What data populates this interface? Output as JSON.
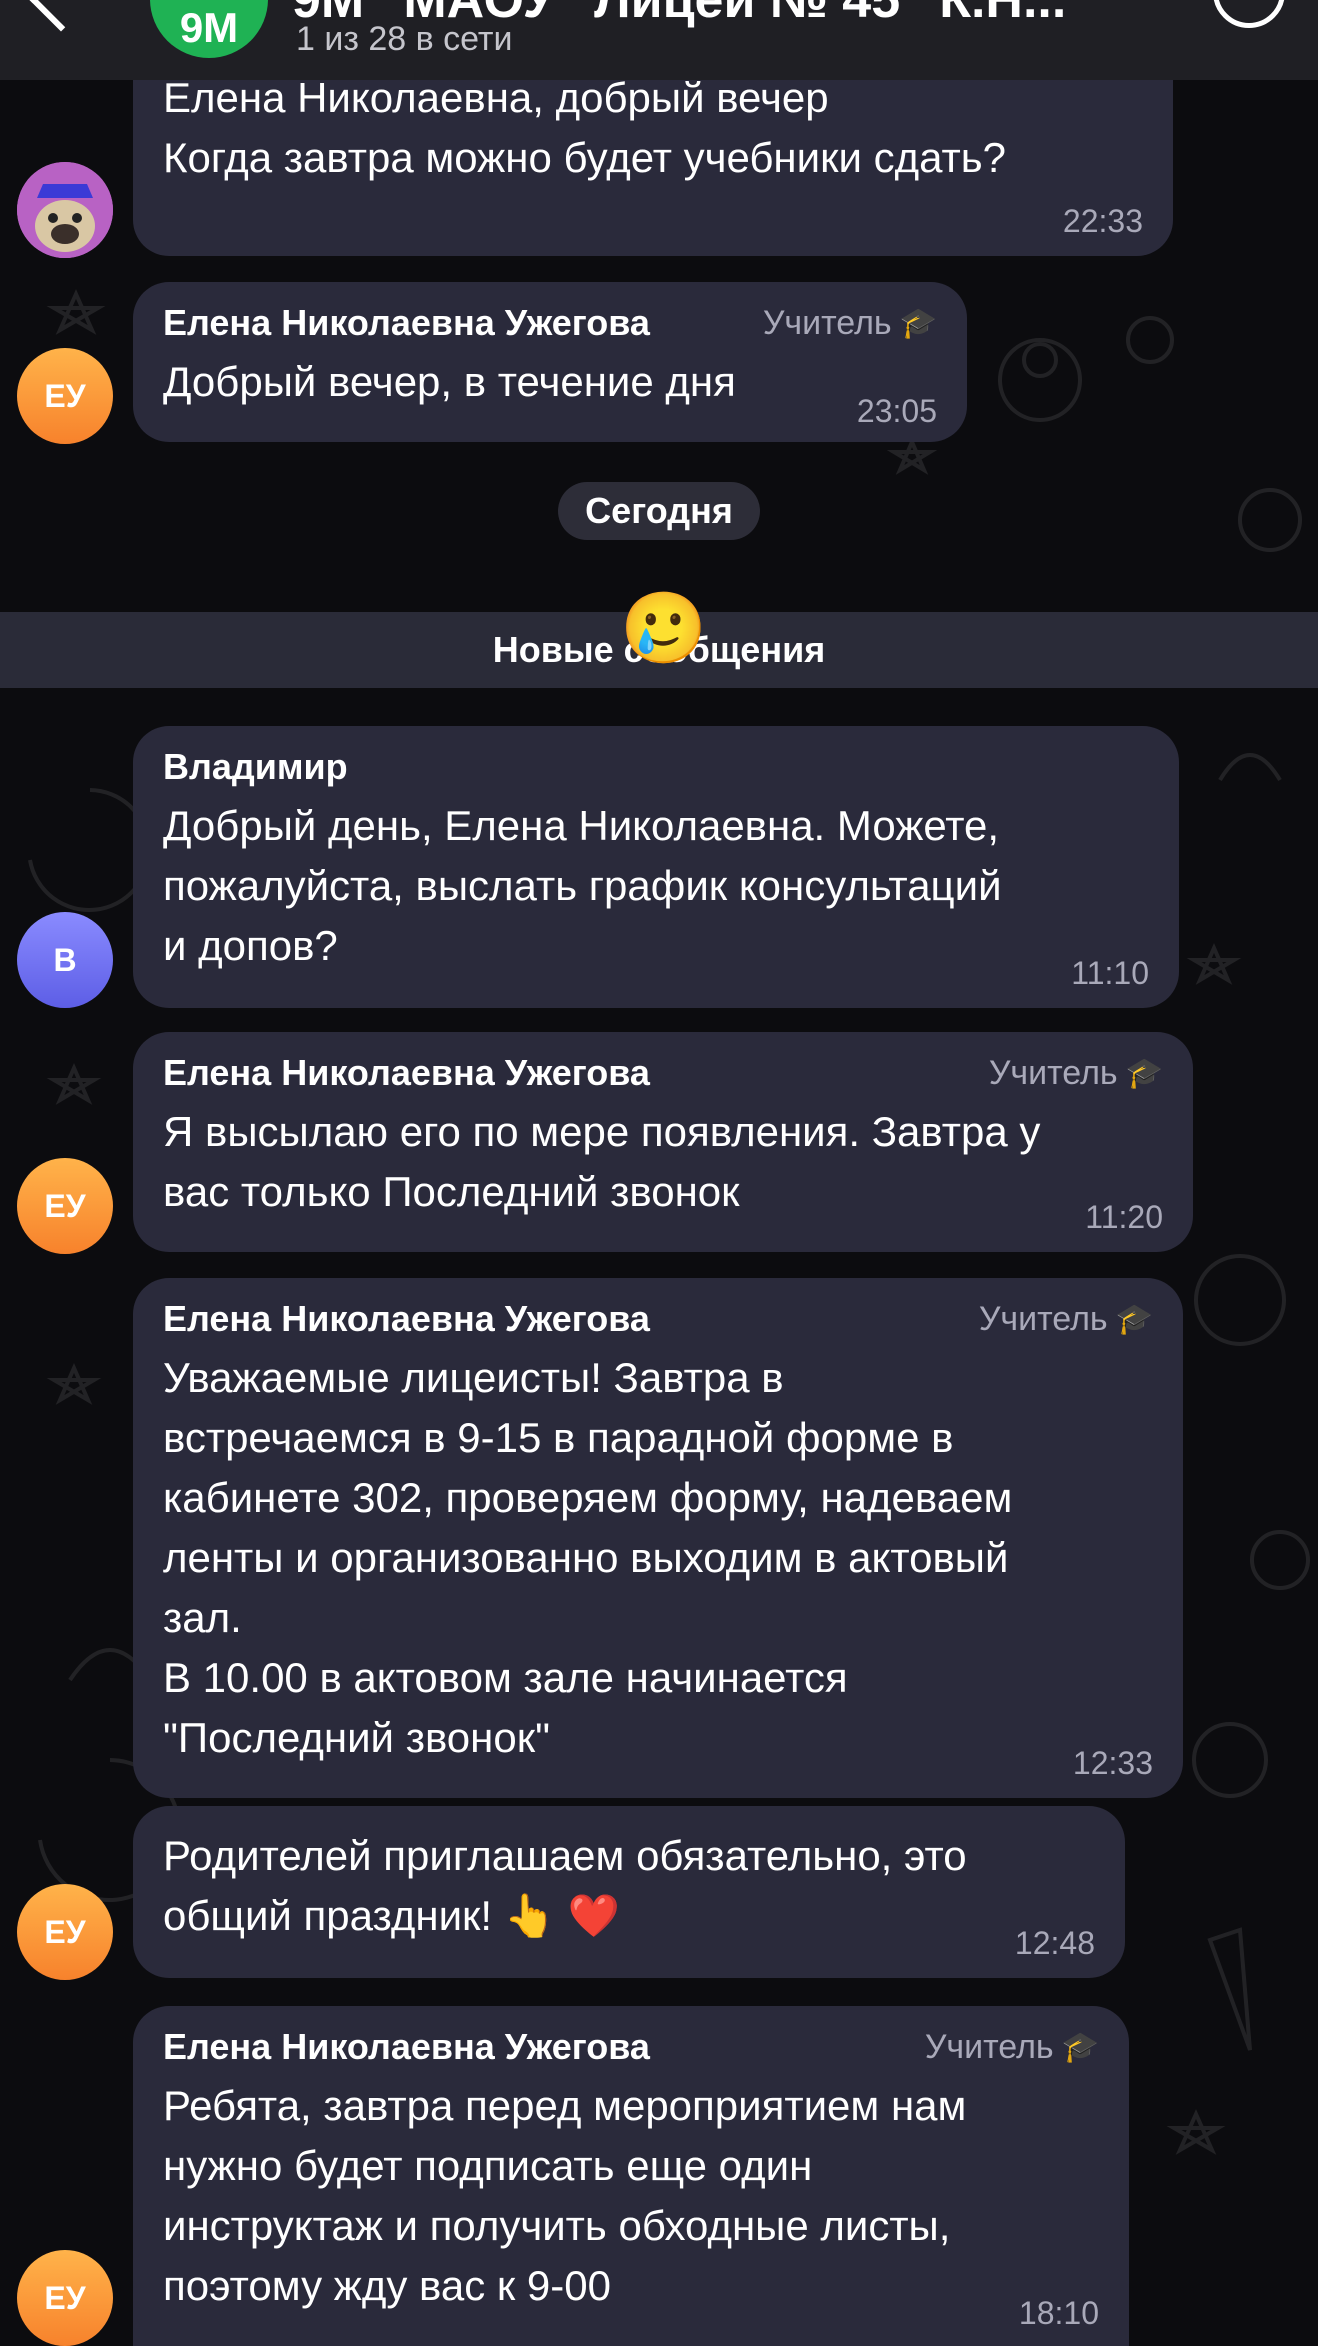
{
  "header": {
    "avatar_initials": "9М",
    "title": "9М \"МАОУ \"Лицей № 45\" К.Н...",
    "subtitle": "1 из 28 в сети"
  },
  "teacher": {
    "name": "Елена Николаевна Ужегова",
    "role": "Учитель",
    "initials": "ЕУ"
  },
  "messages": {
    "m1": {
      "text": "Елена Николаевна, добрый вечер\nКогда завтра можно будет учебники сдать?",
      "time": "22:33"
    },
    "m2": {
      "text": "Добрый вечер, в течение дня",
      "time": "23:05"
    },
    "m3": {
      "sender": "Владимир",
      "initials": "В",
      "text": "Добрый день, Елена Николаевна. Можете,\nпожалуйста, выслать график консультаций\nи допов?",
      "time": "11:10"
    },
    "m4": {
      "text": "Я высылаю его по мере появления. Завтра у\nвас только Последний звонок",
      "time": "11:20"
    },
    "m5": {
      "text": "Уважаемые лицеисты! Завтра в\nвстречаемся в 9-15 в парадной форме в\nкабинете 302, проверяем форму, надеваем\nленты и организованно выходим в актовый\nзал.\nВ 10.00 в актовом зале начинается\n\"Последний звонок\"",
      "time": "12:33"
    },
    "m6": {
      "text": "Родителей приглашаем обязательно, это\nобщий праздник! 👆 ❤️",
      "time": "12:48"
    },
    "m7": {
      "text": "Ребята, завтра перед мероприятием нам\nнужно будет подписать еще один\nинструктаж и получить обходные листы,\nпоэтому жду вас к 9-00",
      "time": "18:10"
    }
  },
  "date_separator": "Сегодня",
  "new_messages_label": "Новые сообщения",
  "floating_emoji": "🥲",
  "icons": [
    "back-arrow-icon",
    "more-menu-icon",
    "graduation-cap-icon"
  ],
  "colors": {
    "background": "#0c0c0f",
    "bubble": "#2a2a3b",
    "header": "#1f1f24",
    "group_avatar": "#1fb254",
    "teacher_avatar": "#f7822c",
    "vladimir_avatar": "#6e6ff0"
  }
}
